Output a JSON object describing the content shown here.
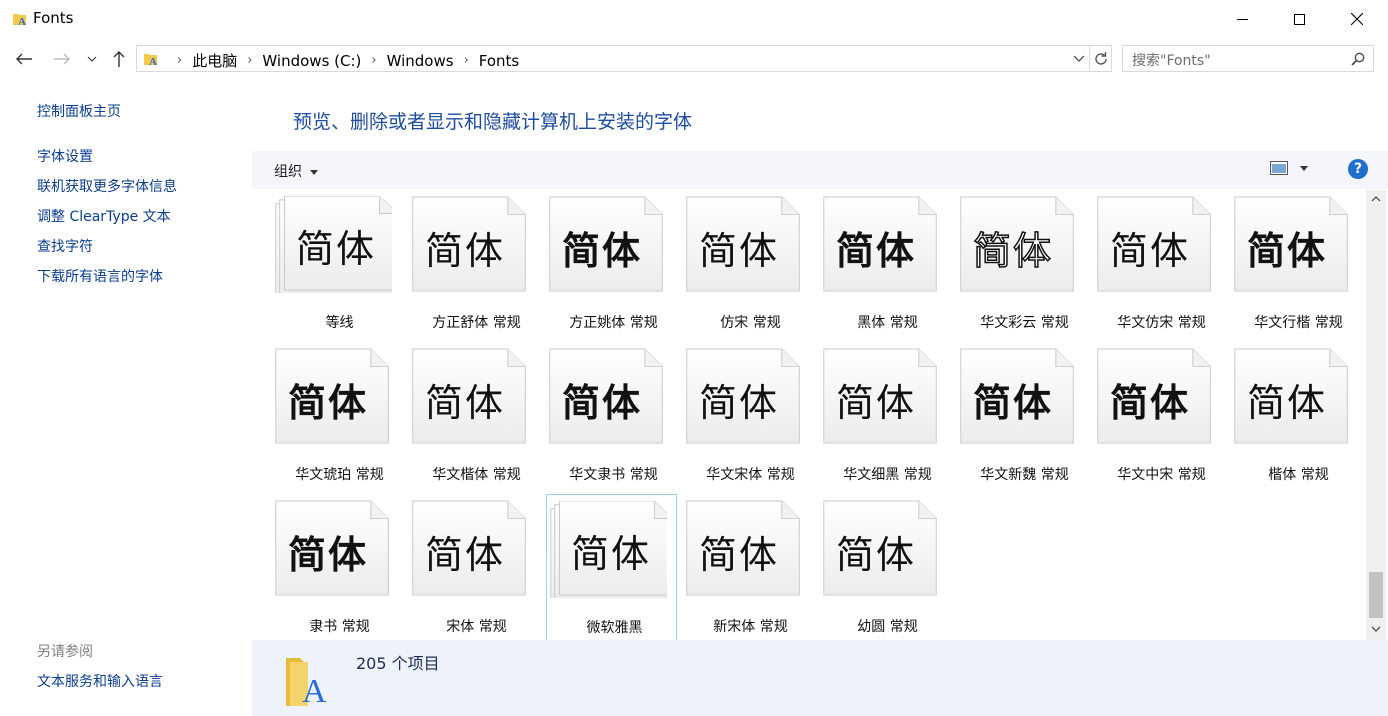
{
  "window": {
    "title": "Fonts"
  },
  "nav": {
    "back": "←",
    "forward": "→",
    "recent": "⌄",
    "up": "↑",
    "breadcrumbs": [
      "此电脑",
      "Windows (C:)",
      "Windows",
      "Fonts"
    ],
    "search_placeholder": "搜索\"Fonts\""
  },
  "sidebar": {
    "home": "控制面板主页",
    "links": [
      "字体设置",
      "联机获取更多字体信息",
      "调整 ClearType 文本",
      "查找字符",
      "下载所有语言的字体"
    ],
    "see_also_heading": "另请参阅",
    "see_also": [
      "文本服务和输入语言"
    ]
  },
  "main": {
    "heading": "预览、删除或者显示和隐藏计算机上安装的字体",
    "organize_label": "组织",
    "help": "?"
  },
  "sample_text": "简体",
  "fonts": [
    {
      "label": "等线",
      "stack": true
    },
    {
      "label": "方正舒体 常规"
    },
    {
      "label": "方正姚体 常规"
    },
    {
      "label": "仿宋 常规"
    },
    {
      "label": "黑体 常规"
    },
    {
      "label": "华文彩云 常规"
    },
    {
      "label": "华文仿宋 常规"
    },
    {
      "label": "华文行楷 常规"
    },
    {
      "label": "华文琥珀 常规"
    },
    {
      "label": "华文楷体 常规"
    },
    {
      "label": "华文隶书 常规"
    },
    {
      "label": "华文宋体 常规"
    },
    {
      "label": "华文细黑 常规"
    },
    {
      "label": "华文新魏 常规"
    },
    {
      "label": "华文中宋 常规"
    },
    {
      "label": "楷体 常规"
    },
    {
      "label": "隶书 常规"
    },
    {
      "label": "宋体 常规"
    },
    {
      "label": "微软雅黑",
      "stack": true,
      "selected": true
    },
    {
      "label": "新宋体 常规"
    },
    {
      "label": "幼圆 常规"
    }
  ],
  "status": {
    "count": "205 个项目"
  }
}
